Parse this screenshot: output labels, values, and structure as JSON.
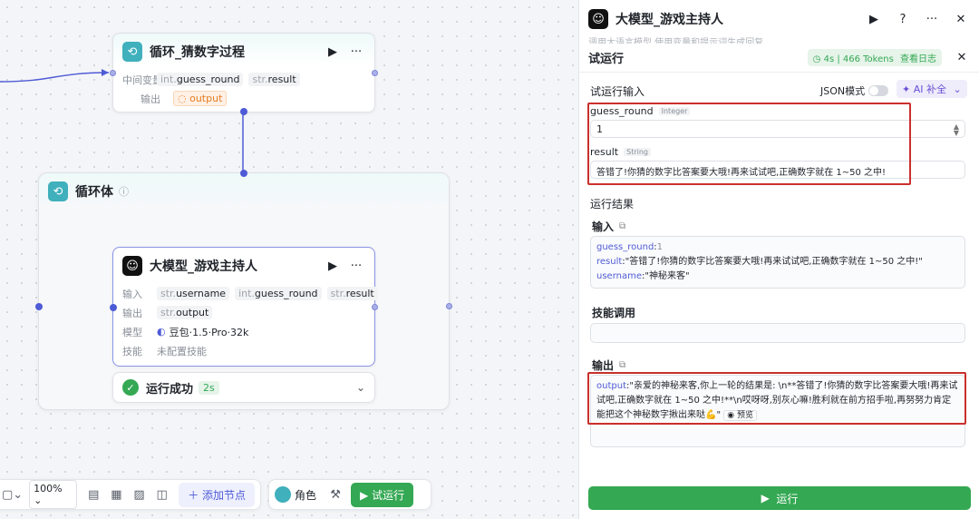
{
  "loop_node": {
    "title": "循环_猜数字过程",
    "var_label": "中间变量",
    "vars": [
      {
        "type": "int.",
        "name": "guess_round"
      },
      {
        "type": "str.",
        "name": "result"
      }
    ],
    "output_label": "输出",
    "output_name": "output"
  },
  "loop_body": {
    "title": "循环体"
  },
  "llm_node": {
    "title": "大模型_游戏主持人",
    "input_label": "输入",
    "inputs": [
      {
        "type": "str.",
        "name": "username"
      },
      {
        "type": "int.",
        "name": "guess_round"
      },
      {
        "type": "str.",
        "name": "result"
      }
    ],
    "output_label": "输出",
    "output": {
      "type": "str.",
      "name": "output"
    },
    "model_label": "模型",
    "model_name": "豆包·1.5·Pro·32k",
    "skill_label": "技能",
    "skill_value": "未配置技能"
  },
  "run_status": {
    "label": "运行成功",
    "duration": "2s"
  },
  "toolbar": {
    "zoom": "100%",
    "add_node": "添加节点",
    "role": "角色",
    "test_run": "试运行"
  },
  "panel": {
    "header_title": "大模型_游戏主持人",
    "header_sub": "调用大语言模型,使用变量和提示词生成回复",
    "title": "试运行",
    "stats": "4s | 466 Tokens",
    "view_log": "查看日志",
    "input_section": "试运行输入",
    "json_mode": "JSON模式",
    "ai_fill": "AI 补全",
    "fields": [
      {
        "name": "guess_round",
        "type": "Integer",
        "value": "1"
      },
      {
        "name": "result",
        "type": "String",
        "value": "答错了!你猜的数字比答案要大哦!再来试试吧,正确数字就在 1~50 之中!"
      }
    ],
    "result_section": "运行结果",
    "input_label": "输入",
    "input_lines": [
      {
        "key": "guess_round",
        "value": "1"
      },
      {
        "key": "result",
        "value": "\"答错了!你猜的数字比答案要大哦!再来试试吧,正确数字就在 1~50 之中!\""
      },
      {
        "key": "username",
        "value": "\"神秘来客\""
      }
    ],
    "skill_label": "技能调用",
    "output_label": "输出",
    "output_key": "output",
    "output_value": "\"亲爱的神秘来客,你上一轮的结果是: \\n**答错了!你猜的数字比答案要大哦!再来试试吧,正确数字就在 1~50 之中!**\\n哎呀呀,别灰心嘛!胜利就在前方招手啦,再努努力肯定能把这个神秘数字揪出来哒💪\"",
    "preview": "预览",
    "run_button": "运行"
  },
  "colors": {
    "accent": "#4e5bd6",
    "success": "#34a853",
    "highlight": "#c9302c",
    "loop_icon": "#3fb0bc"
  }
}
